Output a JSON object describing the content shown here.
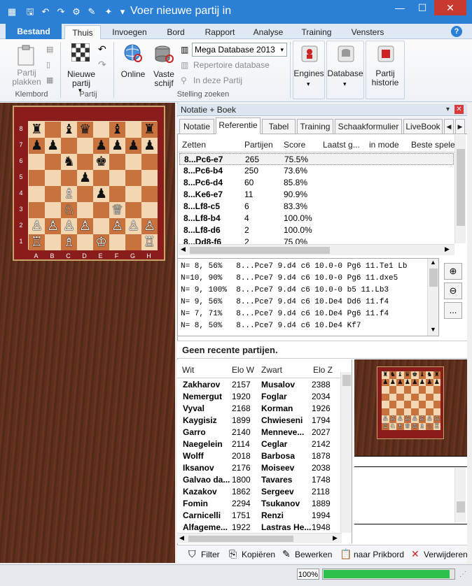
{
  "window": {
    "title": "Voer nieuwe partij in",
    "quick_access": [
      "save-icon",
      "undo-icon",
      "redo-icon",
      "settings-icon",
      "tool-icon",
      "bulb-icon",
      "menu-icon"
    ]
  },
  "ribbon_tabs": [
    "Bestand",
    "Thuis",
    "Invoegen",
    "Bord",
    "Rapport",
    "Analyse",
    "Training",
    "Vensters"
  ],
  "help_label": "?",
  "ribbon": {
    "paste_label": "Partij plakken",
    "clipboard_group": "Klembord",
    "new_game_label": "Nieuwe partij",
    "game_group": "Partij",
    "online_label": "Online",
    "harddisk_label": "Vaste schijf",
    "database_select": "Mega Database 2013",
    "repertoire_label": "Repertoire database",
    "in_game_label": "In deze Partij",
    "search_group": "Stelling zoeken",
    "engines_label": "Engines",
    "database_label": "Database",
    "history_label": "Partij historie"
  },
  "board": {
    "ranks": [
      "8",
      "7",
      "6",
      "5",
      "4",
      "3",
      "2",
      "1"
    ],
    "files": [
      "A",
      "B",
      "C",
      "D",
      "E",
      "F",
      "G",
      "H"
    ],
    "position": [
      [
        "♜",
        "",
        "♝",
        "♛",
        "",
        "♝",
        "",
        "♜"
      ],
      [
        "♟",
        "♟",
        "",
        "",
        "♟",
        "♟",
        "♟",
        "♟"
      ],
      [
        "",
        "",
        "♞",
        "",
        "♚",
        "",
        "",
        ""
      ],
      [
        "",
        "",
        "",
        "♟",
        "",
        "",
        "",
        ""
      ],
      [
        "",
        "",
        "♗",
        "",
        "♟",
        "",
        "",
        ""
      ],
      [
        "",
        "",
        "♘",
        "",
        "",
        "♕",
        "",
        ""
      ],
      [
        "♙",
        "♙",
        "♙",
        "♙",
        "",
        "♙",
        "♙",
        "♙"
      ],
      [
        "♖",
        "",
        "♗",
        "",
        "♔",
        "",
        "",
        "♖"
      ]
    ],
    "colors": [
      [
        "b",
        "",
        "b",
        "b",
        "",
        "b",
        "",
        "b"
      ],
      [
        "b",
        "b",
        "",
        "",
        "b",
        "b",
        "b",
        "b"
      ],
      [
        "",
        "",
        "b",
        "",
        "b",
        "",
        "",
        ""
      ],
      [
        "",
        "",
        "",
        "b",
        "",
        "",
        "",
        ""
      ],
      [
        "",
        "",
        "w",
        "",
        "b",
        "",
        "",
        ""
      ],
      [
        "",
        "",
        "w",
        "",
        "",
        "w",
        "",
        ""
      ],
      [
        "w",
        "w",
        "w",
        "w",
        "",
        "w",
        "w",
        "w"
      ],
      [
        "w",
        "",
        "w",
        "",
        "w",
        "",
        "",
        "w"
      ]
    ]
  },
  "notation": {
    "header": "Notatie + Boek",
    "tabs": [
      "Notatie",
      "Referentie",
      "Tabel",
      "Training",
      "Schaakformulier",
      "LiveBook"
    ],
    "active_tab": "Referentie",
    "columns": [
      "Zetten",
      "Partijen",
      "Score",
      "Laatst g...",
      "in mode",
      "Beste speler"
    ],
    "rows": [
      {
        "move": "8...Pc6-e7",
        "games": "265",
        "score": "75.5%"
      },
      {
        "move": "8...Pc6-b4",
        "games": "250",
        "score": "73.6%"
      },
      {
        "move": "8...Pc6-d4",
        "games": "60",
        "score": "85.8%"
      },
      {
        "move": "8...Ke6-e7",
        "games": "11",
        "score": "90.9%"
      },
      {
        "move": "8...Lf8-c5",
        "games": "6",
        "score": "83.3%"
      },
      {
        "move": "8...Lf8-b4",
        "games": "4",
        "score": "100.0%"
      },
      {
        "move": "8...Lf8-d6",
        "games": "2",
        "score": "100.0%"
      },
      {
        "move": "8...Dd8-f6",
        "games": "2",
        "score": "75.0%"
      }
    ]
  },
  "book_lines": [
    "N= 8, 56%   8...Pce7 9.d4 c6 10.0-0 Pg6 11.Te1 Lb",
    "N=10, 90%   8...Pce7 9.d4 c6 10.0-0 Pg6 11.dxe5",
    "N= 9, 100%  8...Pce7 9.d4 c6 10.0-0 b5 11.Lb3",
    "N= 9, 56%   8...Pce7 9.d4 c6 10.De4 Dd6 11.f4",
    "N= 7, 71%   8...Pce7 9.d4 c6 10.De4 Pg6 11.f4",
    "N= 8, 50%   8...Pce7 9.d4 c6 10.De4 Kf7"
  ],
  "side_buttons": [
    "zoom-in-icon",
    "zoom-out-icon",
    "..."
  ],
  "recent_text": "Geen recente partijen.",
  "games": {
    "columns": [
      "Wit",
      "Elo W",
      "Zwart",
      "Elo Z"
    ],
    "rows": [
      {
        "white": "Zakharov",
        "elo_w": "2157",
        "black": "Musalov",
        "elo_b": "2388"
      },
      {
        "white": "Nemergut",
        "elo_w": "1920",
        "black": "Foglar",
        "elo_b": "2034"
      },
      {
        "white": "Vyval",
        "elo_w": "2168",
        "black": "Korman",
        "elo_b": "1926"
      },
      {
        "white": "Kaygisiz",
        "elo_w": "1899",
        "black": "Chwieseni",
        "elo_b": "1794"
      },
      {
        "white": "Garro",
        "elo_w": "2140",
        "black": "Menneve...",
        "elo_b": "2027"
      },
      {
        "white": "Naegelein",
        "elo_w": "2114",
        "black": "Ceglar",
        "elo_b": "2142"
      },
      {
        "white": "Wolff",
        "elo_w": "2018",
        "black": "Barbosa",
        "elo_b": "1878"
      },
      {
        "white": "Iksanov",
        "elo_w": "2176",
        "black": "Moiseev",
        "elo_b": "2038"
      },
      {
        "white": "Galvao da...",
        "elo_w": "1800",
        "black": "Tavares",
        "elo_b": "1748"
      },
      {
        "white": "Kazakov",
        "elo_w": "1862",
        "black": "Sergeev",
        "elo_b": "2118"
      },
      {
        "white": "Fomin",
        "elo_w": "2294",
        "black": "Tsukanov",
        "elo_b": "1889"
      },
      {
        "white": "Carnicelli",
        "elo_w": "1751",
        "black": "Renzi",
        "elo_b": "1994"
      },
      {
        "white": "Alfageme...",
        "elo_w": "1922",
        "black": "Lastras He...",
        "elo_b": "1948"
      }
    ]
  },
  "mini_board": [
    [
      "♜",
      "♞",
      "♝",
      "♛",
      "♚",
      "♝",
      "♞",
      "♜"
    ],
    [
      "♟",
      "♟",
      "♟",
      "♟",
      "♟",
      "♟",
      "♟",
      "♟"
    ],
    [
      "",
      "",
      "",
      "",
      "",
      "",
      "",
      ""
    ],
    [
      "",
      "",
      "",
      "",
      "",
      "",
      "",
      ""
    ],
    [
      "",
      "",
      "",
      "",
      "",
      "",
      "",
      ""
    ],
    [
      "",
      "",
      "",
      "",
      "",
      "",
      "",
      ""
    ],
    [
      "♙",
      "♙",
      "♙",
      "♙",
      "♙",
      "♙",
      "♙",
      "♙"
    ],
    [
      "♖",
      "♘",
      "♗",
      "♕",
      "♔",
      "♗",
      "♘",
      "♖"
    ]
  ],
  "bottom_toolbar": [
    "Filter",
    "Kopiëren",
    "Bewerken",
    "naar Prikbord",
    "Verwijderen"
  ],
  "status": {
    "zoom": "100%",
    "progress": 0.97
  }
}
